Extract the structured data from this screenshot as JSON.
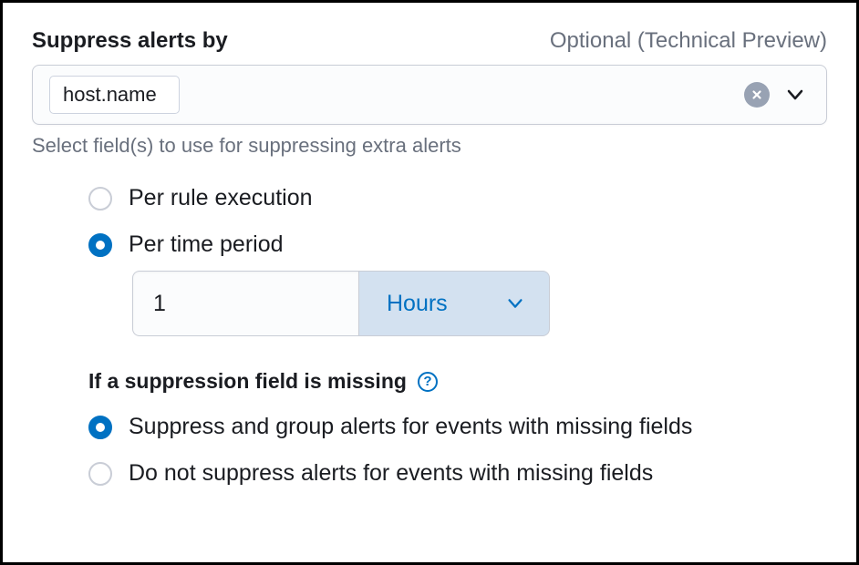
{
  "header": {
    "title": "Suppress alerts by",
    "optional": "Optional (Technical Preview)"
  },
  "combo": {
    "pill_label": "host.name",
    "helper": "Select field(s) to use for suppressing extra alerts"
  },
  "interval": {
    "radio1": "Per rule execution",
    "radio2": "Per time period",
    "value": "1",
    "unit": "Hours"
  },
  "missing": {
    "label": "If a suppression field is missing",
    "radio1": "Suppress and group alerts for events with missing fields",
    "radio2": "Do not suppress alerts for events with missing fields"
  }
}
